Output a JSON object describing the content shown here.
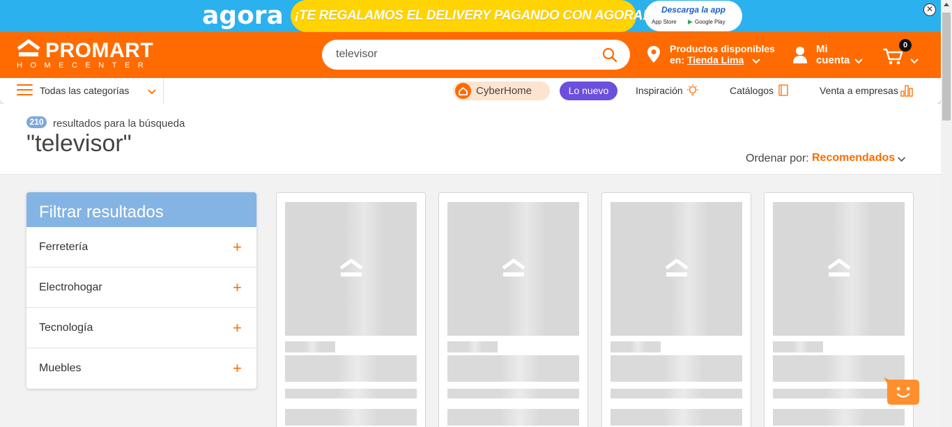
{
  "promo": {
    "brand": "agora",
    "message": "¡TE REGALAMOS EL DELIVERY PAGANDO CON AGORA!",
    "app_title": "Descarga la app",
    "app_store": "App Store",
    "google_play": "Google Play",
    "close": "✕",
    "colors": {
      "background": "#2ab1ee",
      "pill": "#ffd400"
    }
  },
  "header": {
    "logo_name": "PROMART",
    "logo_sub": "HOMECENTER",
    "search": {
      "value": "televisor",
      "placeholder": ""
    },
    "location": {
      "line1": "Productos disponibles",
      "line2_prefix": "en: ",
      "store": "Tienda Lima"
    },
    "account": {
      "line1": "Mi",
      "line2": "cuenta"
    },
    "cart_count": "0",
    "colors": {
      "brand": "#ff6b00"
    }
  },
  "nav": {
    "categories": "Todas las categorías",
    "cyberhome": "CyberHome",
    "new": "Lo nuevo",
    "inspiration": "Inspiración",
    "catalogs": "Catálogos",
    "business": "Venta a empresas"
  },
  "results": {
    "count": "210",
    "label": "resultados para la búsqueda",
    "query": "\"televisor\"",
    "sort_label": "Ordenar por:",
    "sort_value": "Recomendados"
  },
  "filter": {
    "title": "Filtrar resultados",
    "items": [
      {
        "label": "Ferretería",
        "icon": "plus-icon"
      },
      {
        "label": "Electrohogar",
        "icon": "plus-icon"
      },
      {
        "label": "Tecnología",
        "icon": "plus-icon"
      },
      {
        "label": "Muebles",
        "icon": "plus-icon"
      }
    ]
  },
  "products": {
    "state": "loading-skeleton",
    "card_count": 4
  }
}
